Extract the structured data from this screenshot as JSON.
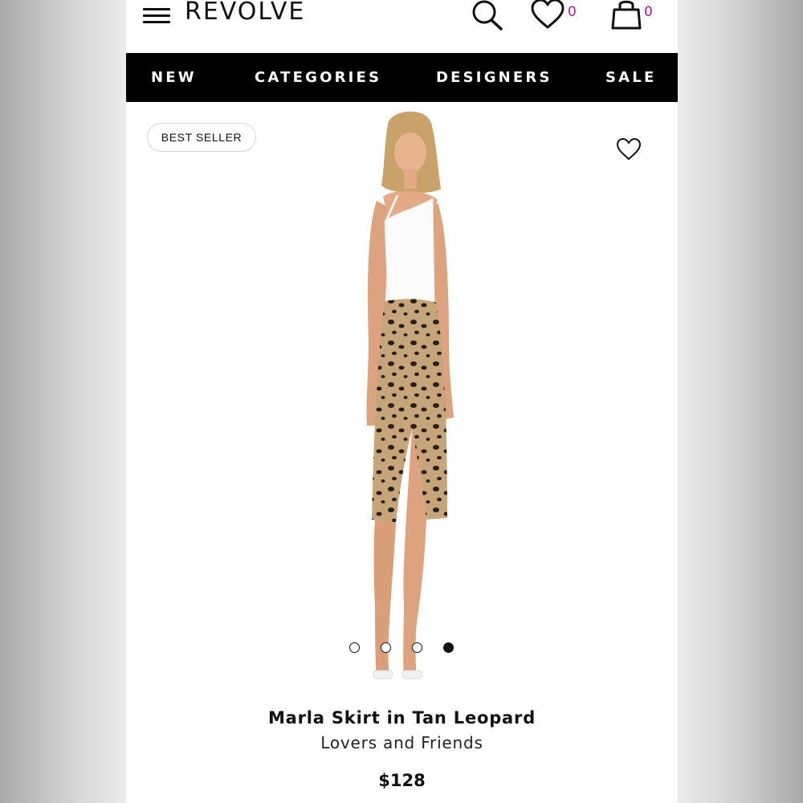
{
  "header": {
    "logo": "REVOLVE",
    "wishlist_count": "0",
    "bag_count": "0",
    "count_color": "#b5188e"
  },
  "nav": {
    "items": [
      {
        "label": "NEW"
      },
      {
        "label": "CATEGORIES"
      },
      {
        "label": "DESIGNERS"
      },
      {
        "label": "SALE"
      }
    ]
  },
  "product": {
    "badge": "BEST SELLER",
    "title": "Marla Skirt in Tan Leopard",
    "brand": "Lovers and Friends",
    "price": "$128",
    "image_description_icon": "model-photo",
    "carousel": {
      "total": 4,
      "active_index": 4
    }
  },
  "icons": [
    "menu-icon",
    "search-icon",
    "heart-icon",
    "bag-icon",
    "favorite-heart-icon"
  ]
}
